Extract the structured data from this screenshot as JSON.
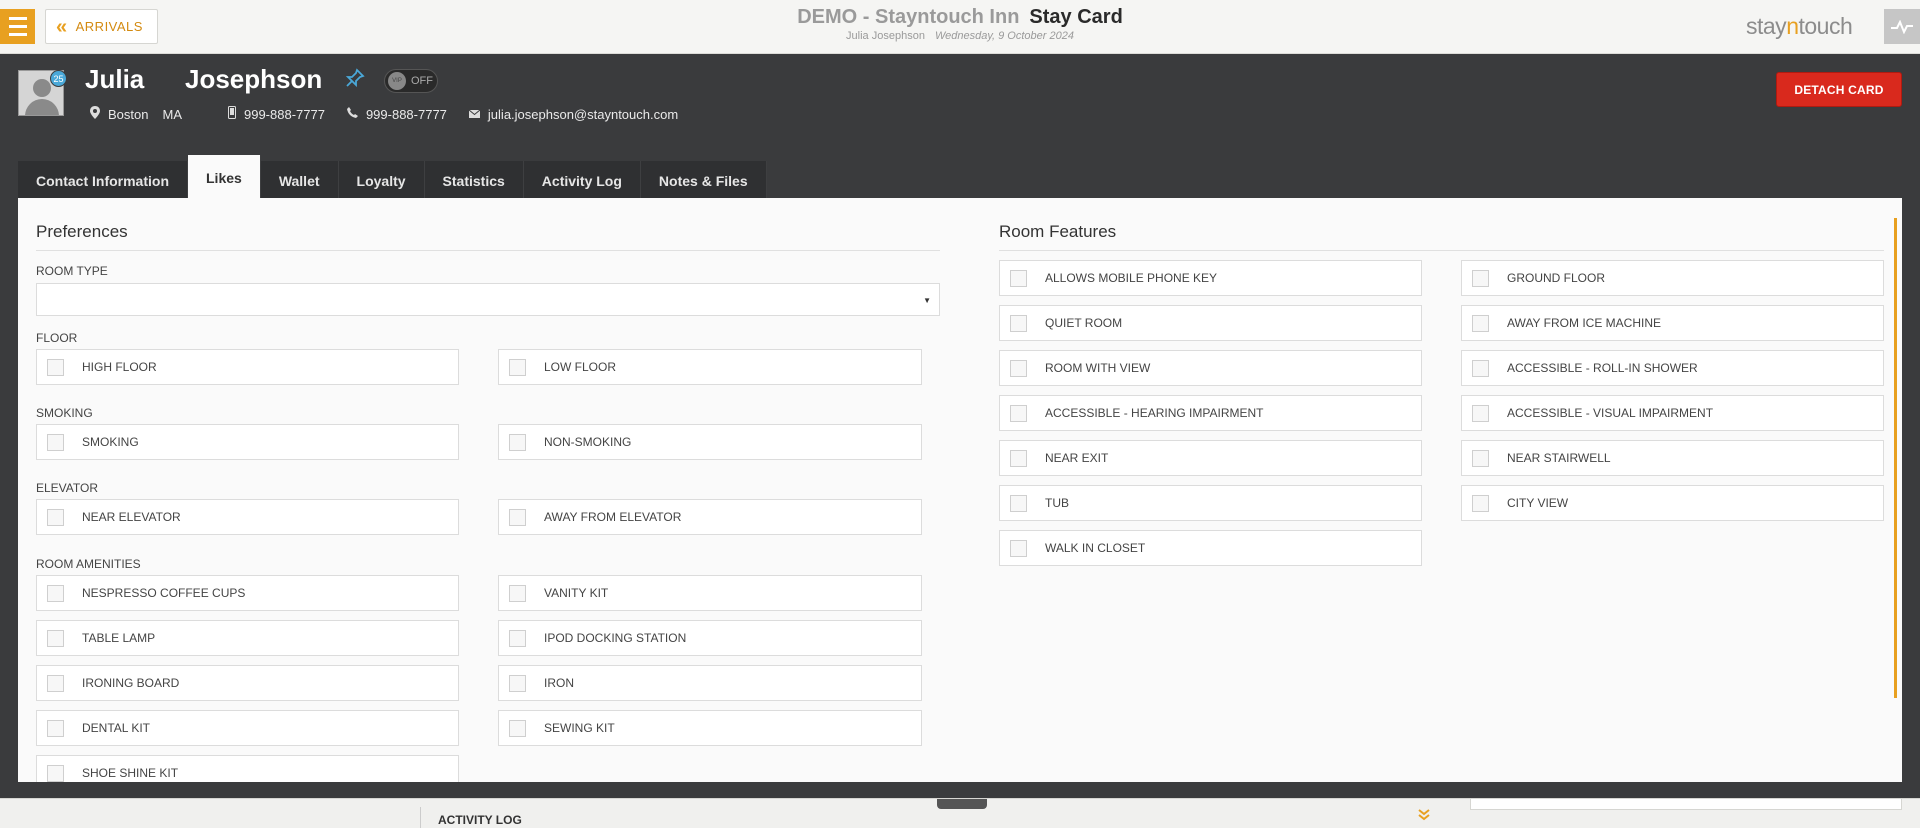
{
  "topbar": {
    "back_label": "ARRIVALS",
    "hotel": "DEMO - Stayntouch Inn",
    "page_title": "Stay Card",
    "guest": "Julia Josephson",
    "date": "Wednesday, 9 October 2024",
    "logo_a": "stay",
    "logo_b": "n",
    "logo_c": "touch"
  },
  "guest": {
    "first_name": "Julia",
    "last_name": "Josephson",
    "age_badge": "25",
    "vip_knob": "VIP",
    "vip_state": "OFF",
    "city": "Boston",
    "state": "MA",
    "mobile": "999-888-7777",
    "phone": "999-888-7777",
    "email": "julia.josephson@stayntouch.com",
    "detach_label": "DETACH CARD"
  },
  "tabs": [
    "Contact Information",
    "Likes",
    "Wallet",
    "Loyalty",
    "Statistics",
    "Activity Log",
    "Notes & Files"
  ],
  "active_tab": "Likes",
  "preferences": {
    "title": "Preferences",
    "room_type_label": "ROOM TYPE",
    "room_type_value": "",
    "floor_label": "FLOOR",
    "floor": [
      "HIGH FLOOR",
      "LOW FLOOR"
    ],
    "smoking_label": "SMOKING",
    "smoking": [
      "SMOKING",
      "NON-SMOKING"
    ],
    "elevator_label": "ELEVATOR",
    "elevator": [
      "NEAR ELEVATOR",
      "AWAY FROM ELEVATOR"
    ],
    "amenities_label": "ROOM AMENITIES",
    "amenities": [
      "NESPRESSO COFFEE CUPS",
      "VANITY KIT",
      "TABLE LAMP",
      "IPOD DOCKING STATION",
      "IRONING BOARD",
      "IRON",
      "DENTAL KIT",
      "SEWING KIT",
      "SHOE SHINE KIT"
    ]
  },
  "room_features": {
    "title": "Room Features",
    "items": [
      "ALLOWS MOBILE PHONE KEY",
      "GROUND FLOOR",
      "QUIET ROOM",
      "AWAY FROM ICE MACHINE",
      "ROOM WITH VIEW",
      "ACCESSIBLE - ROLL-IN SHOWER",
      "ACCESSIBLE - HEARING IMPAIRMENT",
      "ACCESSIBLE - VISUAL IMPAIRMENT",
      "NEAR EXIT",
      "NEAR STAIRWELL",
      "TUB",
      "CITY VIEW",
      "WALK IN CLOSET"
    ]
  },
  "bottom": {
    "activity_log_label": "ACTIVITY LOG"
  },
  "colors": {
    "accent": "#e8a020",
    "header_dark": "#3a3b3d",
    "detach_red": "#d9291d",
    "info_blue": "#4aa8d8"
  }
}
